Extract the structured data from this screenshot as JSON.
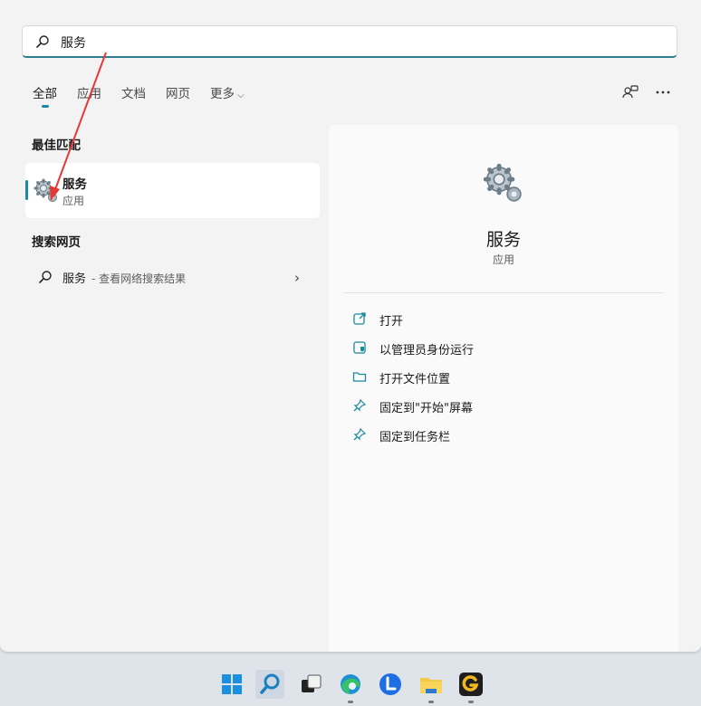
{
  "search": {
    "value": "服务"
  },
  "tabs": [
    {
      "label": "全部",
      "active": true
    },
    {
      "label": "应用"
    },
    {
      "label": "文档"
    },
    {
      "label": "网页"
    },
    {
      "label": "更多"
    }
  ],
  "toolbar": {
    "share_icon": "people-icon",
    "more_icon": "more-dots-icon"
  },
  "best_match": {
    "heading": "最佳匹配",
    "title": "服务",
    "subtitle": "应用",
    "icon": "services-gear-icon"
  },
  "web_search": {
    "heading": "搜索网页",
    "query": "服务",
    "hint": "- 查看网络搜索结果"
  },
  "detail": {
    "title": "服务",
    "subtitle": "应用",
    "actions": [
      {
        "label": "打开",
        "icon": "open-external-icon"
      },
      {
        "label": "以管理员身份运行",
        "icon": "shield-admin-icon"
      },
      {
        "label": "打开文件位置",
        "icon": "folder-icon"
      },
      {
        "label": "固定到\"开始\"屏幕",
        "icon": "pin-icon"
      },
      {
        "label": "固定到任务栏",
        "icon": "pin-icon"
      }
    ]
  },
  "taskbar": {
    "apps": [
      {
        "name": "start-button",
        "icon": "windows-logo-icon"
      },
      {
        "name": "search-button",
        "icon": "search-icon"
      },
      {
        "name": "task-view-button",
        "icon": "task-view-icon"
      },
      {
        "name": "edge-app",
        "icon": "edge-icon"
      },
      {
        "name": "blue-l-app",
        "icon": "letter-l-icon"
      },
      {
        "name": "file-explorer-app",
        "icon": "folder-icon"
      },
      {
        "name": "g-app",
        "icon": "letter-g-icon"
      }
    ]
  },
  "colors": {
    "accent": "#1a8a9e",
    "panel": "#f3f3f3",
    "taskbar": "#dfe3ea"
  }
}
